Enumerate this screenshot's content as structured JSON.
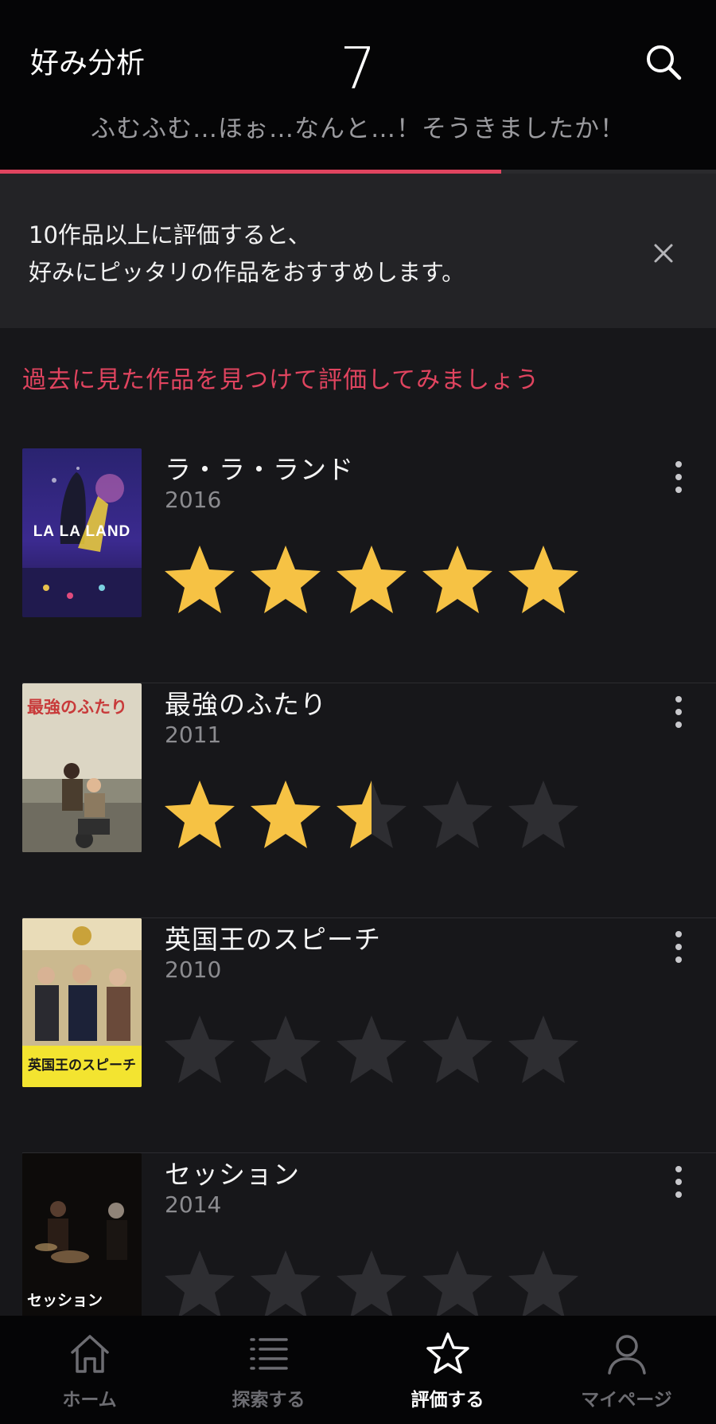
{
  "header": {
    "title": "好み分析",
    "rated_count": "7",
    "subtitle": "ふむふむ…ほぉ…なんと…！そうきましたか！",
    "progress_fraction": 0.7
  },
  "banner": {
    "line1": "10作品以上に評価すると、",
    "line2": "好みにピッタリの作品をおすすめします。"
  },
  "section": {
    "heading": "過去に見た作品を見つけて評価してみましょう"
  },
  "movies": [
    {
      "title": "ラ・ラ・ランド",
      "year": "2016",
      "rating": 5,
      "poster_text": "LA LA LAND"
    },
    {
      "title": "最強のふたり",
      "year": "2011",
      "rating": 2.5,
      "poster_text": "最強のふたり"
    },
    {
      "title": "英国王のスピーチ",
      "year": "2010",
      "rating": 0,
      "poster_text": "英国王のスピーチ"
    },
    {
      "title": "セッション",
      "year": "2014",
      "rating": 0,
      "poster_text": "セッション"
    }
  ],
  "tabs": [
    {
      "label": "ホーム",
      "icon": "home-icon"
    },
    {
      "label": "探索する",
      "icon": "list-icon"
    },
    {
      "label": "評価する",
      "icon": "star-outline-icon",
      "active": true
    },
    {
      "label": "マイページ",
      "icon": "person-icon"
    }
  ],
  "colors": {
    "accent": "#e0445f",
    "star_filled": "#f6c244",
    "star_empty": "#2e2e32"
  }
}
